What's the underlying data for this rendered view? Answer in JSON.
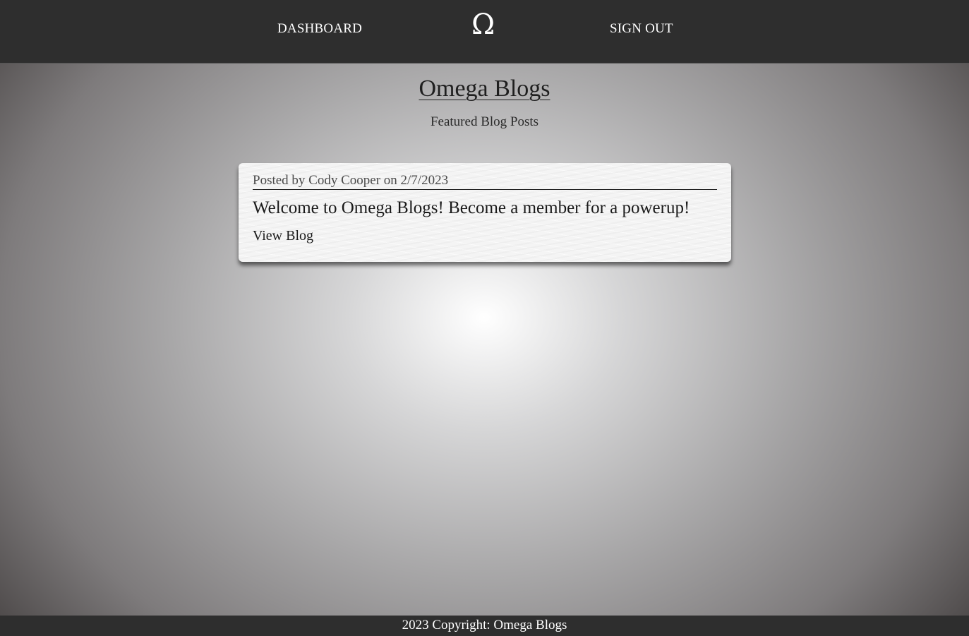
{
  "navbar": {
    "dashboard_label": "DASHBOARD",
    "logo_symbol": "Ω",
    "signout_label": "SIGN OUT"
  },
  "header": {
    "title": "Omega Blogs",
    "subtitle": "Featured Blog Posts"
  },
  "posts": [
    {
      "meta": "Posted by Cody Cooper on 2/7/2023",
      "title": "Welcome to Omega Blogs! Become a member for a powerup!",
      "link_label": "View Blog"
    }
  ],
  "footer": {
    "copyright": "2023 Copyright: Omega Blogs"
  },
  "colors": {
    "navbar_bg": "#2e2e2e",
    "nav_text": "#ffffff",
    "card_bg": "#f4f4f4"
  }
}
